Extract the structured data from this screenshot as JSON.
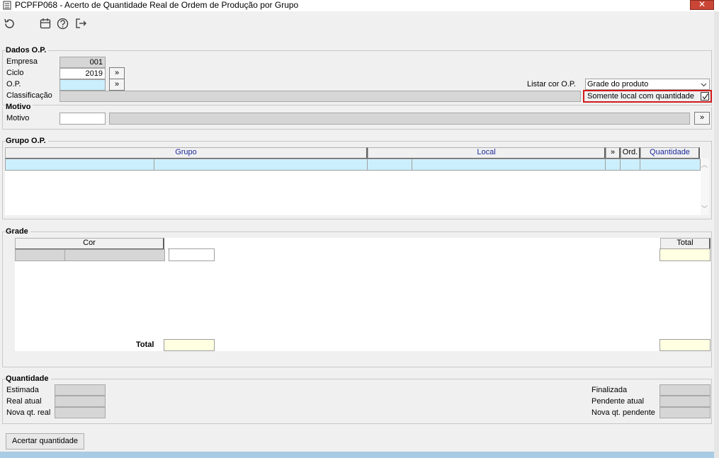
{
  "window": {
    "title": "PCPFP068 - Acerto de Quantidade Real de Ordem de Produção por Grupo",
    "close_glyph": "✕"
  },
  "toolbar": {
    "refresh_icon": "refresh-icon",
    "calendar_icon": "calendar-icon",
    "help_icon": "help-icon",
    "exit_icon": "exit-icon"
  },
  "dados_op": {
    "title": "Dados O.P.",
    "empresa_label": "Empresa",
    "empresa_value": "001",
    "ciclo_label": "Ciclo",
    "ciclo_value": "2019",
    "op_label": "O.P.",
    "op_value": "",
    "classificacao_label": "Classificação",
    "listar_label": "Listar cor O.P.",
    "listar_value": "Grade do produto",
    "somente_label": "Somente local com quantidade",
    "somente_checked": true,
    "lookup_glyph": "»"
  },
  "motivo": {
    "title": "Motivo",
    "label": "Motivo",
    "lookup_glyph": "»"
  },
  "grupo_op": {
    "title": "Grupo O.P.",
    "columns": {
      "grupo": "Grupo",
      "local": "Local",
      "expand": "»",
      "ord": "Ord.",
      "quantidade": "Quantidade"
    },
    "scroll_up": "︿",
    "scroll_down": "﹀"
  },
  "grade": {
    "title": "Grade",
    "cor_header": "Cor",
    "total_header": "Total",
    "total_label": "Total"
  },
  "quantidade": {
    "title": "Quantidade",
    "estimada_label": "Estimada",
    "real_atual_label": "Real atual",
    "nova_real_label": "Nova qt. real",
    "finalizada_label": "Finalizada",
    "pendente_atual_label": "Pendente atual",
    "nova_pendente_label": "Nova qt. pendente"
  },
  "actions": {
    "acertar_label": "Acertar quantidade"
  }
}
